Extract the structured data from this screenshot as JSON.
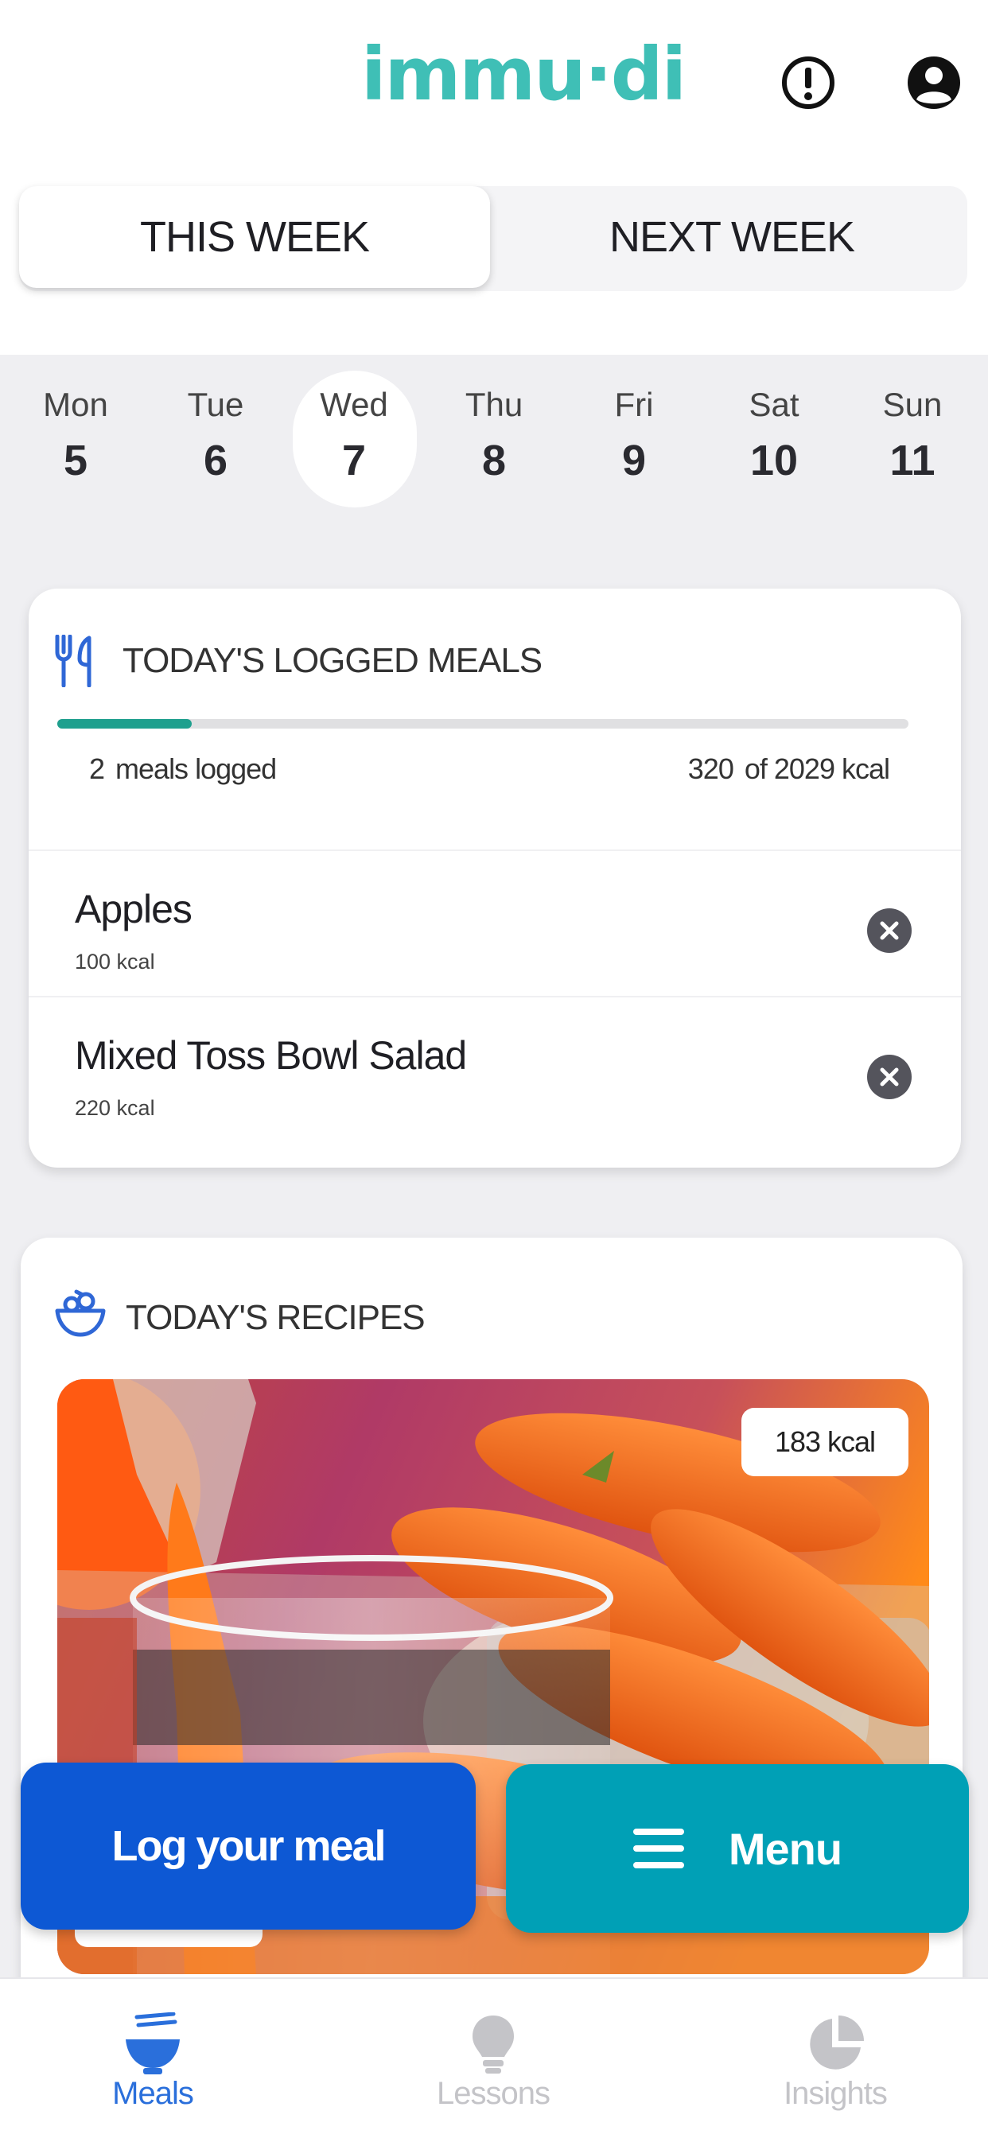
{
  "app": {
    "logo_text": "immu·di"
  },
  "header": {
    "alert_icon": "alert-circle-icon",
    "profile_icon": "account-circle-icon"
  },
  "week_toggle": {
    "options": [
      "THIS WEEK",
      "NEXT WEEK"
    ],
    "selected": "THIS WEEK"
  },
  "days": [
    {
      "name": "Mon",
      "num": "5"
    },
    {
      "name": "Tue",
      "num": "6"
    },
    {
      "name": "Wed",
      "num": "7",
      "selected": true
    },
    {
      "name": "Thu",
      "num": "8"
    },
    {
      "name": "Fri",
      "num": "9"
    },
    {
      "name": "Sat",
      "num": "10"
    },
    {
      "name": "Sun",
      "num": "11"
    }
  ],
  "logged_meals": {
    "title": "TODAY'S LOGGED MEALS",
    "icon": "fork-knife-icon",
    "meals_count": "2",
    "meals_label": "meals logged",
    "kcal_consumed": "320",
    "kcal_target_label": "of 2029 kcal",
    "progress_fraction": 0.158,
    "items": [
      {
        "name": "Apples",
        "kcal": "100 kcal"
      },
      {
        "name": "Mixed Toss Bowl Salad",
        "kcal": "220 kcal"
      }
    ]
  },
  "recipes": {
    "title": "TODAY'S RECIPES",
    "icon": "bowl-icon",
    "featured": {
      "kcal_badge": "183 kcal",
      "image": "carrot-juice-photo"
    }
  },
  "actions": {
    "log_meal": "Log your meal",
    "menu": "Menu"
  },
  "bottom_nav": {
    "items": [
      {
        "label": "Meals",
        "icon": "bowl-icon",
        "active": true
      },
      {
        "label": "Lessons",
        "icon": "lightbulb-icon",
        "active": false
      },
      {
        "label": "Insights",
        "icon": "pie-chart-icon",
        "active": false
      }
    ]
  },
  "colors": {
    "brand_teal": "#3fbfb6",
    "primary_blue": "#0d58d4",
    "menu_teal": "#00a0b6",
    "progress_green": "#1fa08e",
    "nav_active": "#2a6fdb",
    "nav_inactive": "#c4c4c8"
  }
}
